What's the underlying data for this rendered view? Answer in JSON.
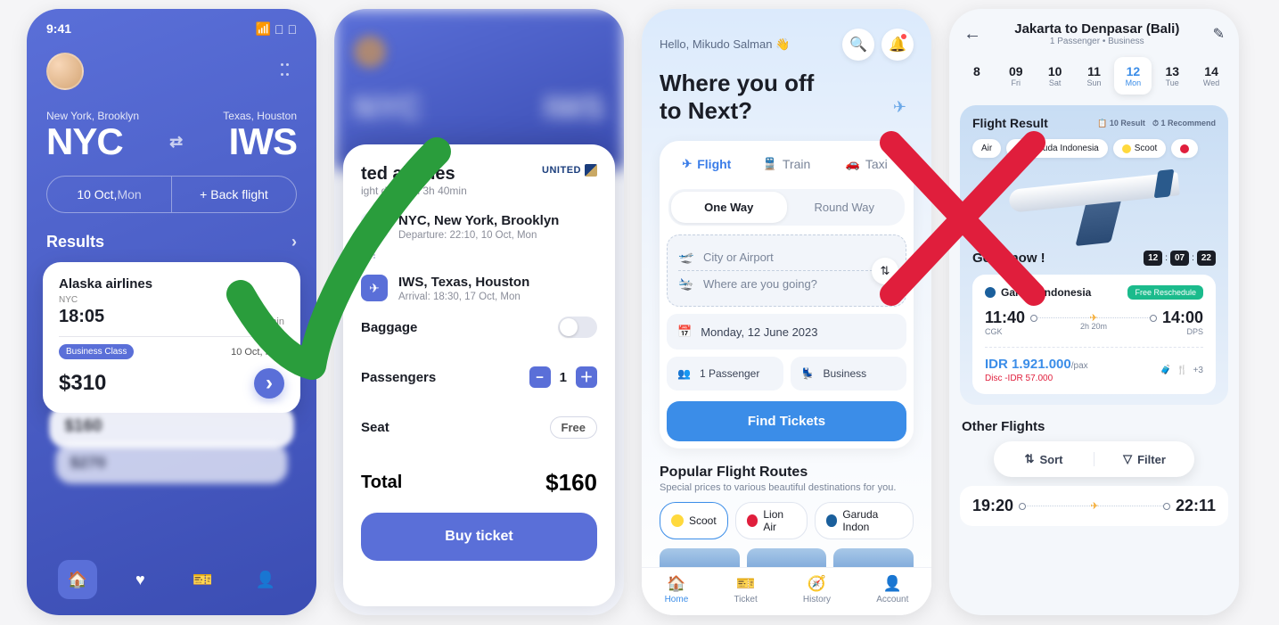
{
  "phone1": {
    "status_time": "9:41",
    "origin_label": "New York, Brooklyn",
    "origin_code": "NYC",
    "dest_label": "Texas, Houston",
    "dest_code": "IWS",
    "date_pill": "10 Oct,",
    "date_pill_day": "Mon",
    "back_flight": "+ Back flight",
    "results_label": "Results",
    "card": {
      "airline": "Alaska airlines",
      "from_code": "NYC",
      "time": "18:05",
      "duration": "4h 10min",
      "class": "Business Class",
      "date": "10 Oct, Mon",
      "price": "$310"
    },
    "blur1": "$160",
    "blur2": "$270"
  },
  "phone2": {
    "bg_codes": {
      "a": "NYC",
      "b": "IWS"
    },
    "title_prefix": "ted airlines",
    "airline_full": "United airlines",
    "brand": "UNITED",
    "duration": "ight duration 3h 40min",
    "leg1": {
      "t1": "NYC, New York, Brooklyn",
      "t2": "Departure: 22:10, 10 Oct, Mon"
    },
    "leg2": {
      "t1": "IWS, Texas, Houston",
      "t2": "Arrival: 18:30, 17 Oct, Mon"
    },
    "baggage": "Baggage",
    "passengers": "Passengers",
    "passenger_count": "1",
    "seat": "Seat",
    "seat_value": "Free",
    "total": "Total",
    "total_amount": "$160",
    "buy": "Buy ticket"
  },
  "phone3": {
    "hello": "Hello, Mikudo Salman 👋",
    "headline1": "Where you off",
    "headline2": "to Next?",
    "tabs": {
      "flight": "Flight",
      "train": "Train",
      "taxi": "Taxi"
    },
    "trip": {
      "oneway": "One Way",
      "round": "Round Way"
    },
    "from_ph": "City or Airport",
    "to_ph": "Where are you going?",
    "date": "Monday, 12 June 2023",
    "pax": "1 Passenger",
    "class": "Business",
    "find": "Find Tickets",
    "pop_title": "Popular Flight Routes",
    "pop_sub": "Special prices to various beautiful destinations for you.",
    "chips": {
      "scoot": "Scoot",
      "lion": "Lion Air",
      "garuda": "Garuda Indon"
    },
    "tabbar": {
      "home": "Home",
      "ticket": "Ticket",
      "history": "History",
      "account": "Account"
    }
  },
  "phone4": {
    "title": "Jakarta to Denpasar (Bali)",
    "subtitle": "1 Passenger  •  Business",
    "dates": [
      {
        "n": "8",
        "w": ""
      },
      {
        "n": "09",
        "w": "Fri"
      },
      {
        "n": "10",
        "w": "Sat"
      },
      {
        "n": "11",
        "w": "Sun"
      },
      {
        "n": "12",
        "w": "Mon"
      },
      {
        "n": "13",
        "w": "Tue"
      },
      {
        "n": "14",
        "w": "Wed"
      },
      {
        "n": "",
        "w": ""
      }
    ],
    "results_title": "Flight Result",
    "results_count": "10 Result",
    "results_rec": "1 Recommend",
    "airlines": {
      "air": "Air",
      "garuda": "Garuda Indonesia",
      "scoot": "Scoot"
    },
    "getit": "Get it now !",
    "countdown": [
      "12",
      "07",
      "22"
    ],
    "card": {
      "airline": "Garuda Indonesia",
      "badge": "Free Reschedule",
      "dep_time": "11:40",
      "dep_code": "CGK",
      "duration": "2h 20m",
      "arr_time": "14:00",
      "arr_code": "DPS",
      "price": "IDR 1.921.000",
      "pax": "/pax",
      "disc": "Disc -IDR 57.000",
      "extras": "+3"
    },
    "other": "Other Flights",
    "sort": "Sort",
    "filter": "Filter",
    "card2": {
      "dep": "19:20",
      "arr": "22:11"
    }
  }
}
